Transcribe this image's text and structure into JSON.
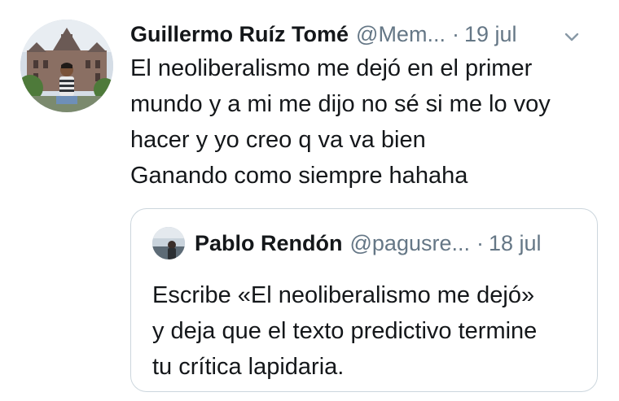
{
  "tweet": {
    "author_name": "Guillermo Ruíz Tomé",
    "handle": "@Mem...",
    "separator": "·",
    "time": "19 jul",
    "menu_icon": "chevron-down-icon",
    "lines": [
      "El neoliberalismo me dejó en el primer",
      "mundo y a mi me dijo no sé si me lo voy",
      "hacer y yo creo q va va bien",
      "Ganando como siempre hahaha"
    ]
  },
  "quoted_tweet": {
    "author_name": "Pablo Rendón",
    "handle": "@pagusre...",
    "separator": "·",
    "time": "18 jul",
    "lines": [
      "Escribe «El neoliberalismo me dejó»",
      "y deja que el texto predictivo termine",
      "tu crítica lapidaria."
    ]
  },
  "colors": {
    "text": "#14171a",
    "secondary": "#657786",
    "border": "#ccd6dd",
    "background": "#ffffff"
  }
}
